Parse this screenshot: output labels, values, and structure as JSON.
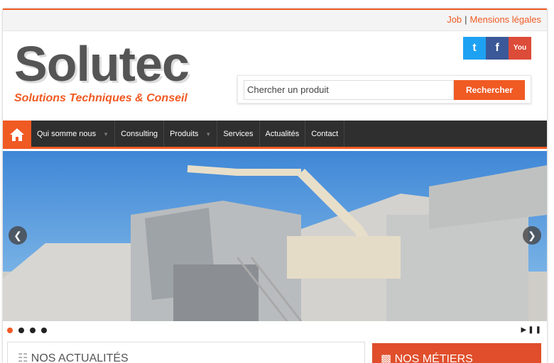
{
  "topbar": {
    "job": "Job",
    "separator": "|",
    "legal": "Mensions légales"
  },
  "brand": {
    "name": "Solutec",
    "tagline": "Solutions Techniques & Conseil"
  },
  "social": {
    "twitter": "t",
    "facebook": "f",
    "youtube": "You"
  },
  "search": {
    "placeholder": "Chercher un produit",
    "button": "Rechercher"
  },
  "nav": {
    "items": [
      {
        "label": "Qui somme nous",
        "has_dropdown": true
      },
      {
        "label": "Consulting",
        "has_dropdown": false
      },
      {
        "label": "Produits",
        "has_dropdown": true
      },
      {
        "label": "Services",
        "has_dropdown": false
      },
      {
        "label": "Actualités",
        "has_dropdown": false
      },
      {
        "label": "Contact",
        "has_dropdown": false
      }
    ]
  },
  "slider": {
    "dots": 4,
    "active_dot": 1
  },
  "panels": {
    "news": "NOS ACTUALITÉS",
    "jobs": "NOS MÉTIERS"
  },
  "colors": {
    "accent": "#f05a23",
    "nav_bg": "#2f2f2f"
  }
}
